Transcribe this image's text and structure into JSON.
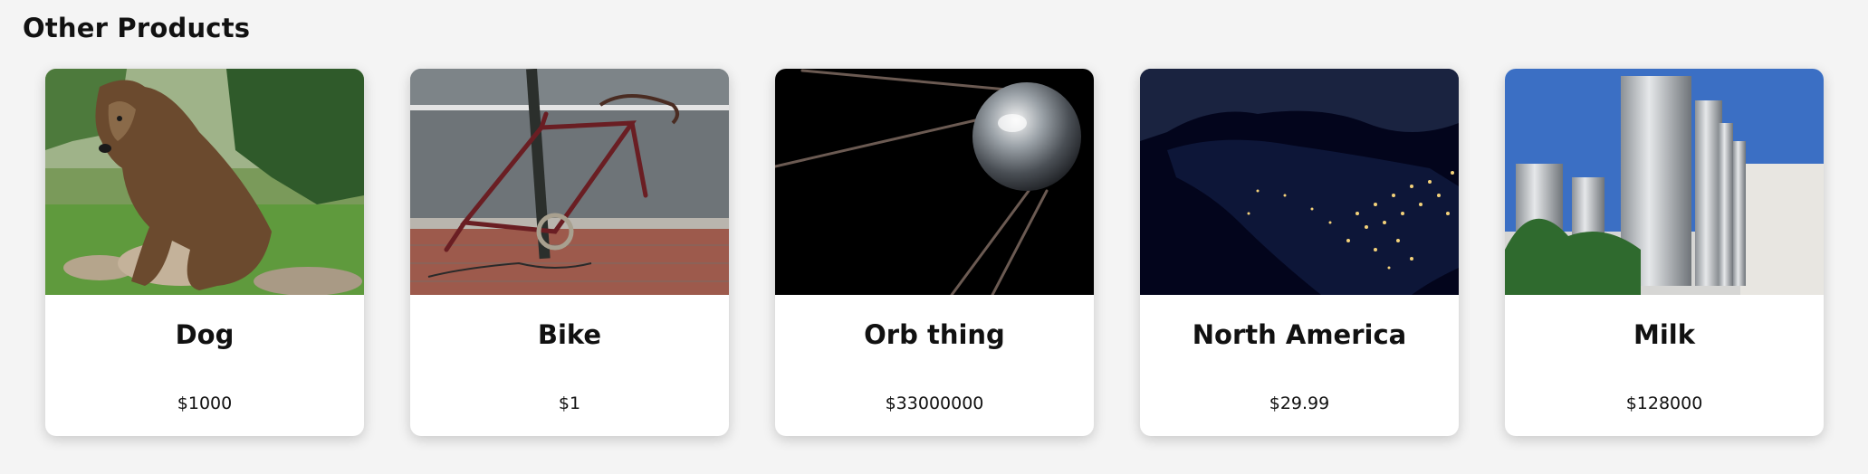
{
  "section": {
    "title": "Other Products"
  },
  "products": [
    {
      "name": "Dog",
      "price": "$1000",
      "image": "brown-bear-photo"
    },
    {
      "name": "Bike",
      "price": "$1",
      "image": "locked-bike-frame-photo"
    },
    {
      "name": "Orb thing",
      "price": "$33000000",
      "image": "sputnik-satellite-photo"
    },
    {
      "name": "North America",
      "price": "$29.99",
      "image": "north-america-night-lights-photo"
    },
    {
      "name": "Milk",
      "price": "$128000",
      "image": "steel-silos-photo"
    }
  ]
}
